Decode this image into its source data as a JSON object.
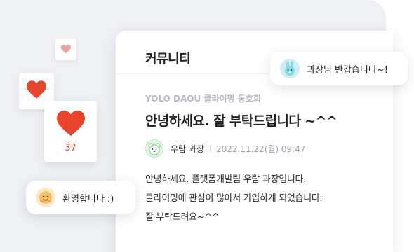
{
  "card": {
    "title": "커뮤니티"
  },
  "post": {
    "community": "YOLO DAOU 클라이밍 동호회",
    "title": "안녕하세요. 잘 부탁드립니다 ~^^",
    "author": "우람 과장",
    "date": "2022.11.22(월) 09:47",
    "body_lines": [
      "안녕하세요. 플랫폼개발팀 우람 과장입니다.",
      "클라이밍에 관심이 많아서 가입하게 되었습니다.",
      "잘 부탁드려요~^^"
    ]
  },
  "likes": {
    "count": "37",
    "heart_icon": "heart-icon"
  },
  "bubbles": {
    "right_text": "과장님 반갑습니다~!",
    "left_text": "환영합니다 :)"
  },
  "colors": {
    "heart": "#e8442e",
    "heart_light": "#f0a39a",
    "background": "#eef0f4"
  }
}
